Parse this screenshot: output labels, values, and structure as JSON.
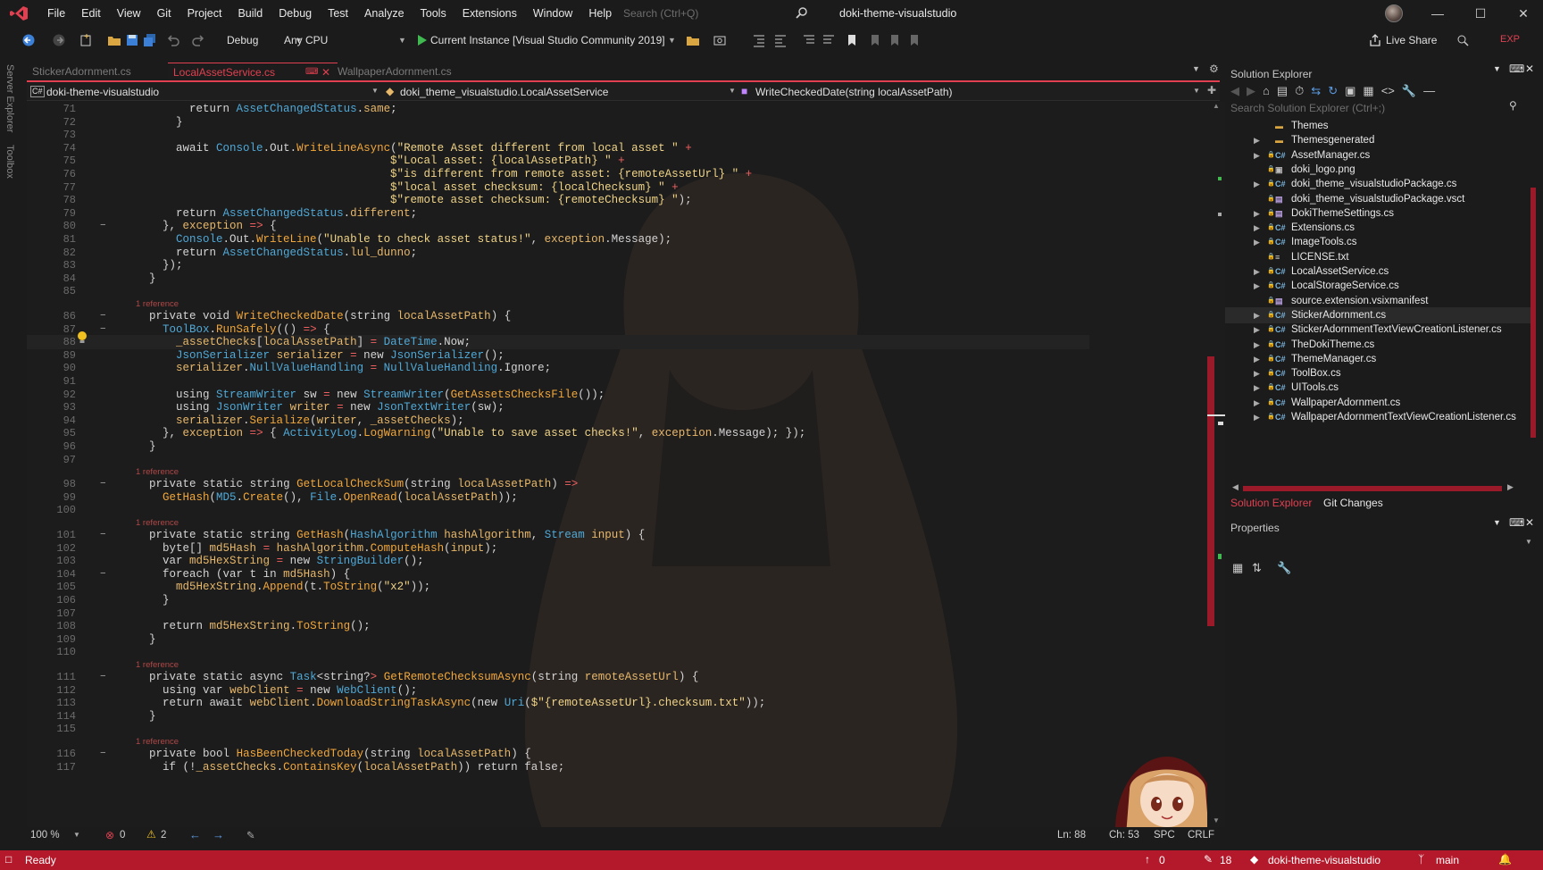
{
  "window": {
    "title": "doki-theme-visualstudio",
    "search_placeholder": "Search (Ctrl+Q)",
    "exp_badge": "EXP",
    "live_share": "Live Share"
  },
  "menu": [
    "File",
    "Edit",
    "View",
    "Git",
    "Project",
    "Build",
    "Debug",
    "Test",
    "Analyze",
    "Tools",
    "Extensions",
    "Window",
    "Help"
  ],
  "toolbar": {
    "config": "Debug",
    "platform": "Any CPU",
    "run_target": "Current Instance [Visual Studio Community 2019]"
  },
  "side_tabs": [
    "Server Explorer",
    "Toolbox"
  ],
  "tabs": [
    {
      "label": "StickerAdornment.cs",
      "active": false
    },
    {
      "label": "LocalAssetService.cs",
      "active": true
    },
    {
      "label": "WallpaperAdornment.cs",
      "active": false
    }
  ],
  "navbar": {
    "project": "doki-theme-visualstudio",
    "class": "doki_theme_visualstudio.LocalAssetService",
    "member": "WriteCheckedDate(string localAssetPath)"
  },
  "code": [
    {
      "n": "71",
      "t": "        return AssetChangedStatus.same;"
    },
    {
      "n": "72",
      "t": "      }"
    },
    {
      "n": "73",
      "t": ""
    },
    {
      "n": "74",
      "t": "      await Console.Out.WriteLineAsync(\"Remote Asset different from local asset \" +"
    },
    {
      "n": "75",
      "t": "                                      $\"Local asset: {localAssetPath} \" +"
    },
    {
      "n": "76",
      "t": "                                      $\"is different from remote asset: {remoteAssetUrl} \" +"
    },
    {
      "n": "77",
      "t": "                                      $\"local asset checksum: {localChecksum} \" +"
    },
    {
      "n": "78",
      "t": "                                      $\"remote asset checksum: {remoteChecksum} \");"
    },
    {
      "n": "79",
      "t": "      return AssetChangedStatus.different;"
    },
    {
      "n": "80",
      "t": "    }, exception => {"
    },
    {
      "n": "81",
      "t": "      Console.Out.WriteLine(\"Unable to check asset status!\", exception.Message);"
    },
    {
      "n": "82",
      "t": "      return AssetChangedStatus.lul_dunno;"
    },
    {
      "n": "83",
      "t": "    });"
    },
    {
      "n": "84",
      "t": "  }"
    },
    {
      "n": "85",
      "t": ""
    },
    {
      "n": "86",
      "t": "  private void WriteCheckedDate(string localAssetPath) {",
      "ref": "1 reference"
    },
    {
      "n": "87",
      "t": "    ToolBox.RunSafely(() => {"
    },
    {
      "n": "88",
      "t": "      _assetChecks[localAssetPath] = DateTime.Now;"
    },
    {
      "n": "89",
      "t": "      JsonSerializer serializer = new JsonSerializer();"
    },
    {
      "n": "90",
      "t": "      serializer.NullValueHandling = NullValueHandling.Ignore;"
    },
    {
      "n": "91",
      "t": ""
    },
    {
      "n": "92",
      "t": "      using StreamWriter sw = new StreamWriter(GetAssetsChecksFile());"
    },
    {
      "n": "93",
      "t": "      using JsonWriter writer = new JsonTextWriter(sw);"
    },
    {
      "n": "94",
      "t": "      serializer.Serialize(writer, _assetChecks);"
    },
    {
      "n": "95",
      "t": "    }, exception => { ActivityLog.LogWarning(\"Unable to save asset checks!\", exception.Message); });"
    },
    {
      "n": "96",
      "t": "  }"
    },
    {
      "n": "97",
      "t": ""
    },
    {
      "n": "98",
      "t": "  private static string GetLocalCheckSum(string localAssetPath) =>",
      "ref": "1 reference"
    },
    {
      "n": "99",
      "t": "    GetHash(MD5.Create(), File.OpenRead(localAssetPath));"
    },
    {
      "n": "100",
      "t": ""
    },
    {
      "n": "101",
      "t": "  private static string GetHash(HashAlgorithm hashAlgorithm, Stream input) {",
      "ref": "1 reference"
    },
    {
      "n": "102",
      "t": "    byte[] md5Hash = hashAlgorithm.ComputeHash(input);"
    },
    {
      "n": "103",
      "t": "    var md5HexString = new StringBuilder();"
    },
    {
      "n": "104",
      "t": "    foreach (var t in md5Hash) {"
    },
    {
      "n": "105",
      "t": "      md5HexString.Append(t.ToString(\"x2\"));"
    },
    {
      "n": "106",
      "t": "    }"
    },
    {
      "n": "107",
      "t": ""
    },
    {
      "n": "108",
      "t": "    return md5HexString.ToString();"
    },
    {
      "n": "109",
      "t": "  }"
    },
    {
      "n": "110",
      "t": ""
    },
    {
      "n": "111",
      "t": "  private static async Task<string?> GetRemoteChecksumAsync(string remoteAssetUrl) {",
      "ref": "1 reference"
    },
    {
      "n": "112",
      "t": "    using var webClient = new WebClient();"
    },
    {
      "n": "113",
      "t": "    return await webClient.DownloadStringTaskAsync(new Uri($\"{remoteAssetUrl}.checksum.txt\"));"
    },
    {
      "n": "114",
      "t": "  }"
    },
    {
      "n": "115",
      "t": ""
    },
    {
      "n": "116",
      "t": "  private bool HasBeenCheckedToday(string localAssetPath) {",
      "ref": "1 reference"
    },
    {
      "n": "117",
      "t": "    if (!_assetChecks.ContainsKey(localAssetPath)) return false;"
    }
  ],
  "editor_status": {
    "zoom": "100 %",
    "errors": "0",
    "warnings": "2",
    "ln": "Ln: 88",
    "ch": "Ch: 53",
    "spc": "SPC",
    "crlf": "CRLF"
  },
  "status": {
    "ready": "Ready",
    "up": "0",
    "pencil": "18",
    "repo": "doki-theme-visualstudio",
    "branch": "main"
  },
  "solution_explorer": {
    "title": "Solution Explorer",
    "search_placeholder": "Search Solution Explorer (Ctrl+;)",
    "items": [
      {
        "label": "Themes",
        "kind": "folder",
        "expand": false,
        "lock": false
      },
      {
        "label": "Themesgenerated",
        "kind": "folder",
        "expand": true,
        "lock": false
      },
      {
        "label": "AssetManager.cs",
        "kind": "cs",
        "expand": true,
        "lock": true
      },
      {
        "label": "doki_logo.png",
        "kind": "img",
        "expand": false,
        "lock": true
      },
      {
        "label": "doki_theme_visualstudioPackage.cs",
        "kind": "cs",
        "expand": true,
        "lock": true
      },
      {
        "label": "doki_theme_visualstudioPackage.vsct",
        "kind": "file",
        "expand": false,
        "lock": true
      },
      {
        "label": "DokiThemeSettings.cs",
        "kind": "file",
        "expand": true,
        "lock": true
      },
      {
        "label": "Extensions.cs",
        "kind": "cs",
        "expand": true,
        "lock": true
      },
      {
        "label": "ImageTools.cs",
        "kind": "cs",
        "expand": true,
        "lock": true
      },
      {
        "label": "LICENSE.txt",
        "kind": "txt",
        "expand": false,
        "lock": true
      },
      {
        "label": "LocalAssetService.cs",
        "kind": "cs",
        "expand": true,
        "lock": true
      },
      {
        "label": "LocalStorageService.cs",
        "kind": "cs",
        "expand": true,
        "lock": true
      },
      {
        "label": "source.extension.vsixmanifest",
        "kind": "file",
        "expand": false,
        "lock": true
      },
      {
        "label": "StickerAdornment.cs",
        "kind": "cs",
        "expand": true,
        "lock": true,
        "selected": true
      },
      {
        "label": "StickerAdornmentTextViewCreationListener.cs",
        "kind": "cs",
        "expand": true,
        "lock": true
      },
      {
        "label": "TheDokiTheme.cs",
        "kind": "cs",
        "expand": true,
        "lock": true
      },
      {
        "label": "ThemeManager.cs",
        "kind": "cs",
        "expand": true,
        "lock": true
      },
      {
        "label": "ToolBox.cs",
        "kind": "cs",
        "expand": true,
        "lock": true
      },
      {
        "label": "UITools.cs",
        "kind": "cs",
        "expand": true,
        "lock": true
      },
      {
        "label": "WallpaperAdornment.cs",
        "kind": "cs",
        "expand": true,
        "lock": true
      },
      {
        "label": "WallpaperAdornmentTextViewCreationListener.cs",
        "kind": "cs",
        "expand": true,
        "lock": true
      }
    ],
    "bottom_tabs": [
      "Solution Explorer",
      "Git Changes"
    ]
  },
  "properties": {
    "title": "Properties"
  },
  "colors": {
    "accent": "#e04050",
    "statusbar": "#b3192b",
    "bg": "#1c1c1c"
  }
}
